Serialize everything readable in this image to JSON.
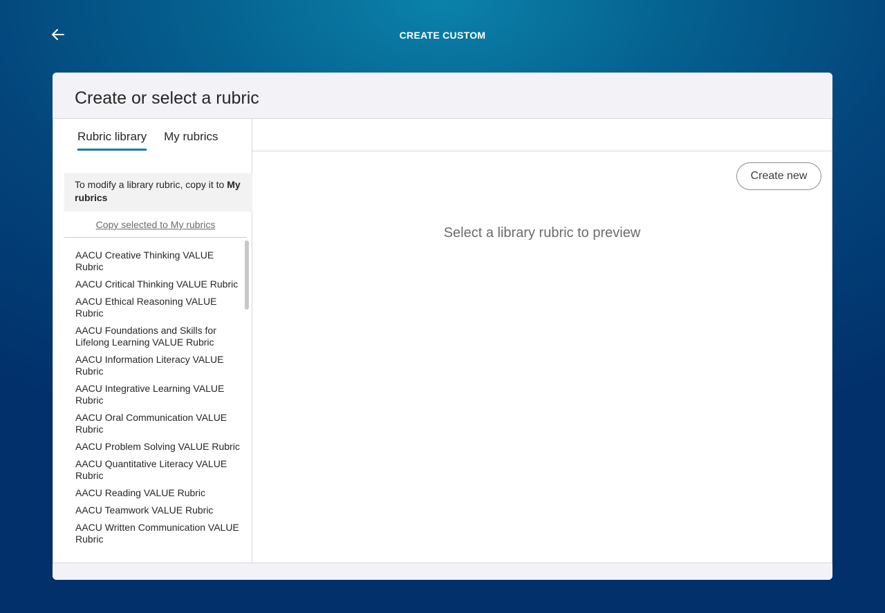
{
  "header": {
    "title": "CREATE CUSTOM",
    "back_icon": "arrow-left-icon"
  },
  "card": {
    "title": "Create or select a rubric"
  },
  "tabs": [
    {
      "label": "Rubric library",
      "active": true
    },
    {
      "label": "My rubrics",
      "active": false
    }
  ],
  "notice": {
    "text": "To modify a library rubric, copy it to ",
    "bold": "My rubrics"
  },
  "copy_link": "Copy selected to My rubrics",
  "rubrics": [
    "AACU Creative Thinking VALUE Rubric",
    "AACU Critical Thinking VALUE Rubric",
    "AACU Ethical Reasoning VALUE Rubric",
    "AACU Foundations and Skills for Lifelong Learning VALUE Rubric",
    "AACU Information Literacy VALUE Rubric",
    "AACU Integrative Learning VALUE Rubric",
    "AACU Oral Communication VALUE Rubric",
    "AACU Problem Solving VALUE Rubric",
    "AACU Quantitative Literacy VALUE Rubric",
    "AACU Reading VALUE Rubric",
    "AACU Teamwork VALUE Rubric",
    "AACU Written Communication VALUE Rubric"
  ],
  "create_new_label": "Create new",
  "preview_message": "Select a library rubric to preview",
  "colors": {
    "accent": "#1a7aa6",
    "background": "#03447b"
  }
}
